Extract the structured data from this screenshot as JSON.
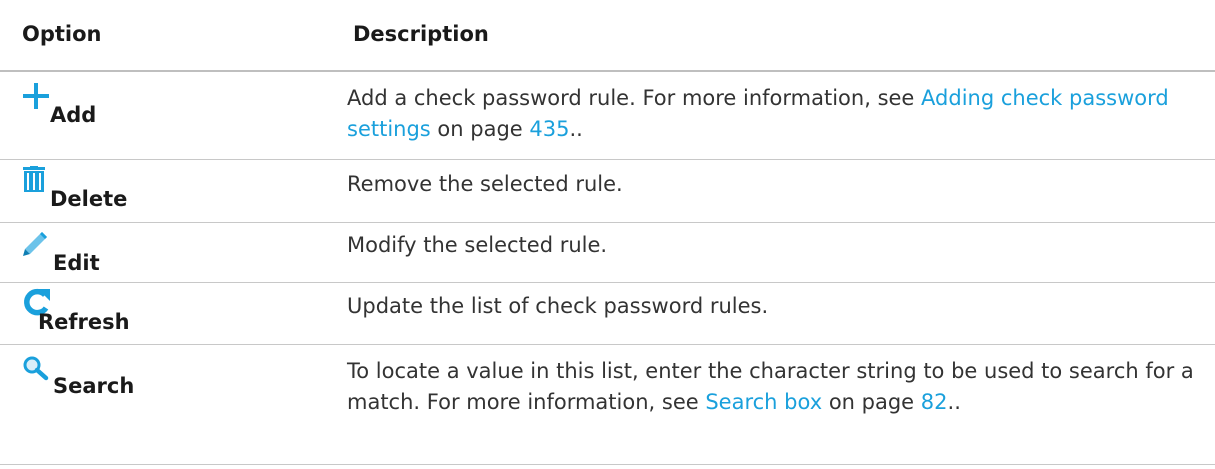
{
  "header": {
    "option": "Option",
    "description": "Description"
  },
  "rows": [
    {
      "icon": "plus-icon",
      "label": "Add",
      "desc_a": "Add a check password rule. For more information, see ",
      "link": "Adding check password settings",
      "desc_b": " on page ",
      "page": "435",
      "desc_c": ".."
    },
    {
      "icon": "trash-icon",
      "label": "Delete",
      "desc": "Remove the selected rule."
    },
    {
      "icon": "pencil-icon",
      "label": "Edit",
      "desc": "Modify the selected rule."
    },
    {
      "icon": "refresh-icon",
      "label": "Refresh",
      "desc": "Update the list of check password rules."
    },
    {
      "icon": "search-icon",
      "label": "Search",
      "desc_a": "To locate a value in this list, enter the character string to be used to search for a match. For more information, see ",
      "link": "Search box",
      "desc_b": " on page ",
      "page": "82",
      "desc_c": ".."
    }
  ],
  "colors": {
    "link": "#1aa0dc",
    "icon": "#1aa0dc",
    "divider": "#c8c8c8"
  }
}
